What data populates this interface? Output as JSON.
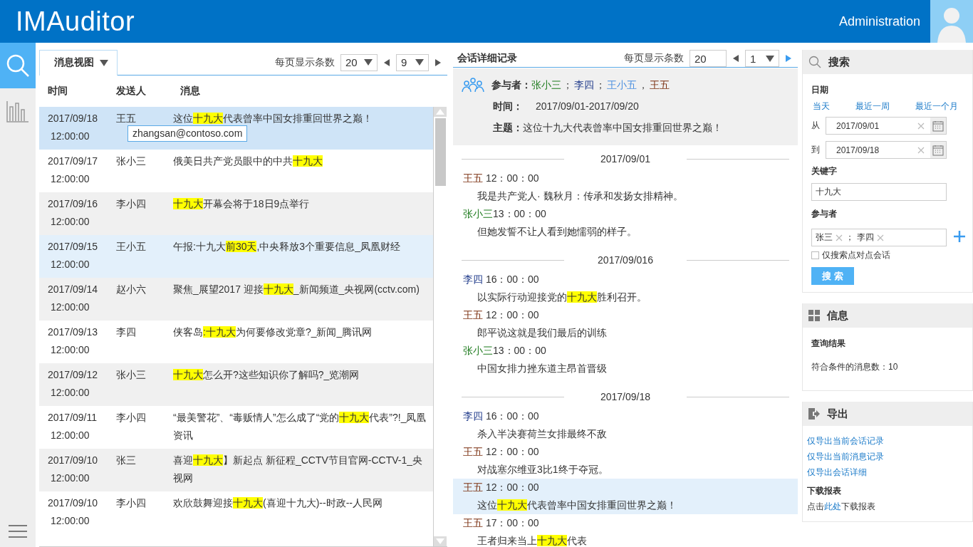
{
  "header": {
    "title": "IMAuditor",
    "user": "Administration"
  },
  "nav": [
    {
      "kind": "search",
      "selected": true
    },
    {
      "kind": "chart",
      "selected": false
    }
  ],
  "messages_panel": {
    "view_label": "消息视图",
    "page_size_label": "每页显示条数",
    "page_size": "20",
    "page": "9",
    "columns": [
      "时间",
      "发送人",
      "消息"
    ],
    "rows": [
      {
        "date": "2017/09/18",
        "time": "12:00:00",
        "sender": "王五",
        "selected": true,
        "hovered": false,
        "tooltip": "zhangsan@contoso.com",
        "message": [
          {
            "text": "这位",
            "highlight": false
          },
          {
            "text": "十九大",
            "highlight": true
          },
          {
            "text": "代表曾率中国女排重回世界之巅！",
            "highlight": false
          }
        ]
      },
      {
        "date": "2017/09/17",
        "time": "12:00:00",
        "sender": "张小三",
        "selected": false,
        "hovered": false,
        "message": [
          {
            "text": "俄美日共产党员眼中的中共",
            "highlight": false
          },
          {
            "text": "十九大",
            "highlight": true
          }
        ]
      },
      {
        "date": "2017/09/16",
        "time": "12:00:00",
        "sender": "李小四",
        "selected": false,
        "hovered": false,
        "message": [
          {
            "text": "十九大",
            "highlight": true
          },
          {
            "text": "开幕会将于18日9点举行",
            "highlight": false
          }
        ]
      },
      {
        "date": "2017/09/15",
        "time": "12:00:00",
        "sender": "王小五",
        "selected": false,
        "hovered": true,
        "message": [
          {
            "text": "午报:十九大",
            "highlight": false
          },
          {
            "text": "前30天",
            "highlight": true
          },
          {
            "text": ",中央释放3个重要信息_凤凰财经",
            "highlight": false
          }
        ]
      },
      {
        "date": "2017/09/14",
        "time": "12:00:00",
        "sender": "赵小六",
        "selected": false,
        "hovered": false,
        "message": [
          {
            "text": "聚焦_展望2017 迎接",
            "highlight": false
          },
          {
            "text": "十九大",
            "highlight": true
          },
          {
            "text": "_新闻频道_央视网(cctv.com)",
            "highlight": false
          }
        ]
      },
      {
        "date": "2017/09/13",
        "time": "12:00:00",
        "sender": "李四",
        "selected": false,
        "hovered": false,
        "message": [
          {
            "text": "侠客岛",
            "highlight": false
          },
          {
            "text": ":十九大",
            "highlight": true
          },
          {
            "text": "为何要修改党章?_新闻_腾讯网",
            "highlight": false
          }
        ]
      },
      {
        "date": "2017/09/12",
        "time": "12:00:00",
        "sender": "张小三",
        "selected": false,
        "hovered": false,
        "message": [
          {
            "text": "十九大",
            "highlight": true
          },
          {
            "text": "怎么开?这些知识你了解吗?_览潮网",
            "highlight": false
          }
        ]
      },
      {
        "date": "2017/09/11",
        "time": "12:00:00",
        "sender": "李小四",
        "selected": false,
        "hovered": false,
        "message": [
          {
            "text": "“最美警花”、“毒贩情人”怎么成了“党的",
            "highlight": false
          },
          {
            "text": "十九大",
            "highlight": true
          },
          {
            "text": "代表”?!_凤凰资讯",
            "highlight": false
          }
        ]
      },
      {
        "date": "2017/09/10",
        "time": "12:00:00",
        "sender": "张三",
        "selected": false,
        "hovered": false,
        "message": [
          {
            "text": "喜迎",
            "highlight": false
          },
          {
            "text": "十九大",
            "highlight": true
          },
          {
            "text": "】新起点 新征程_CCTV节目官网-CCTV-1_央视网",
            "highlight": false
          }
        ]
      },
      {
        "date": "2017/09/10",
        "time": "12:00:00",
        "sender": "李小四",
        "selected": false,
        "hovered": false,
        "message": [
          {
            "text": "欢欣鼓舞迎接",
            "highlight": false
          },
          {
            "text": "十九大",
            "highlight": true
          },
          {
            "text": "(喜迎十九大)--时政--人民网",
            "highlight": false
          }
        ]
      }
    ]
  },
  "conversation": {
    "title": "会话详细记录",
    "page_size_label": "每页显示条数",
    "page_size": "20",
    "page": "1",
    "participants_label": "参与者：",
    "participants": [
      {
        "name": "张小三",
        "color": "#1e7b1e",
        "sep": "；"
      },
      {
        "name": "李四",
        "color": "#1f3a8a",
        "sep": "；"
      },
      {
        "name": "王小五",
        "color": "#4a8fe0",
        "sep": "，"
      },
      {
        "name": "王五",
        "color": "#7a2e0e"
      }
    ],
    "time_label": "时间：",
    "time_value": "2017/09/01-2017/09/20",
    "subject": "**主题：**这位十九大代表曾率中国女排重回世界之巅！",
    "groups": [
      {
        "date": "2017/09/01",
        "entries": [
          {
            "sender": "王五",
            "color": "#7a2e0e",
            "time": " 12：00：00",
            "selected": false,
            "message": [
              {
                "text": "我是共产党人· 魏秋月：传承和发扬女排精神。",
                "highlight": false
              }
            ]
          },
          {
            "sender": "张小三",
            "color": "#1e7b1e",
            "time": "13：00：00",
            "selected": false,
            "message": [
              {
                "text": "但她发誓不让人看到她懦弱的样子。",
                "highlight": false
              }
            ]
          }
        ]
      },
      {
        "date": "2017/09/016",
        "entries": [
          {
            "sender": "李四",
            "color": "#1f3a8a",
            "time": " 16：00：00",
            "selected": false,
            "message": [
              {
                "text": "以实际行动迎接党的",
                "highlight": false
              },
              {
                "text": "十九大",
                "highlight": true
              },
              {
                "text": "胜利召开。",
                "highlight": false
              }
            ]
          },
          {
            "sender": "王五",
            "color": "#7a2e0e",
            "time": " 12：00：00",
            "selected": false,
            "message": [
              {
                "text": "郎平说这就是我们最后的训练",
                "highlight": false
              }
            ]
          },
          {
            "sender": "张小三",
            "color": "#1e7b1e",
            "time": "13：00：00",
            "selected": false,
            "message": [
              {
                "text": "中国女排力挫东道主昂首晋级",
                "highlight": false
              }
            ]
          }
        ]
      },
      {
        "date": "2017/09/18",
        "entries": [
          {
            "sender": "李四",
            "color": "#1f3a8a",
            "time": " 16：00：00",
            "selected": false,
            "message": [
              {
                "text": "杀入半决赛荷兰女排最终不敌",
                "highlight": false
              }
            ]
          },
          {
            "sender": "王五",
            "color": "#7a2e0e",
            "time": " 12：00：00",
            "selected": false,
            "message": [
              {
                "text": "对战塞尔维亚3比1终于夺冠。",
                "highlight": false
              }
            ]
          },
          {
            "sender": "王五",
            "color": "#7a2e0e",
            "time": " 12：00：00",
            "selected": true,
            "message": [
              {
                "text": "这位",
                "highlight": false
              },
              {
                "text": "十九大",
                "highlight": true
              },
              {
                "text": "代表曾率中国女排重回世界之巅！",
                "highlight": false
              }
            ]
          },
          {
            "sender": "王五",
            "color": "#7a2e0e",
            "time": " 17：00：00",
            "selected": false,
            "message": [
              {
                "text": "王者归来当上",
                "highlight": false
              },
              {
                "text": "十九大",
                "highlight": true
              },
              {
                "text": "代表",
                "highlight": false
              }
            ]
          }
        ]
      }
    ]
  },
  "search": {
    "title": "搜索",
    "date_label": "日期",
    "quick_ranges": [
      "当天",
      "最近一周",
      "最近一个月"
    ],
    "from_label": "从",
    "from": "2017/09/01",
    "to_label": "到",
    "to": "2017/09/18",
    "keyword_label": "关键字",
    "keyword": "十九大",
    "participants_label": "参与者",
    "participant_tags": [
      "张三",
      "李四"
    ],
    "tag_separator": "；",
    "p2p_label": "仅搜索点对点会话",
    "p2p_checked": false,
    "button": "搜 索"
  },
  "info": {
    "title": "信息",
    "result_label": "查询结果",
    "count_text": "符合条件的消息数：10"
  },
  "export": {
    "title": "导出",
    "links": [
      "仅导出当前会话记录",
      "仅导出当前消息记录",
      "仅导出会话详细"
    ],
    "download_label": "下载报表",
    "download_before": "点击",
    "download_link": "此处",
    "download_after": "下载报表"
  }
}
